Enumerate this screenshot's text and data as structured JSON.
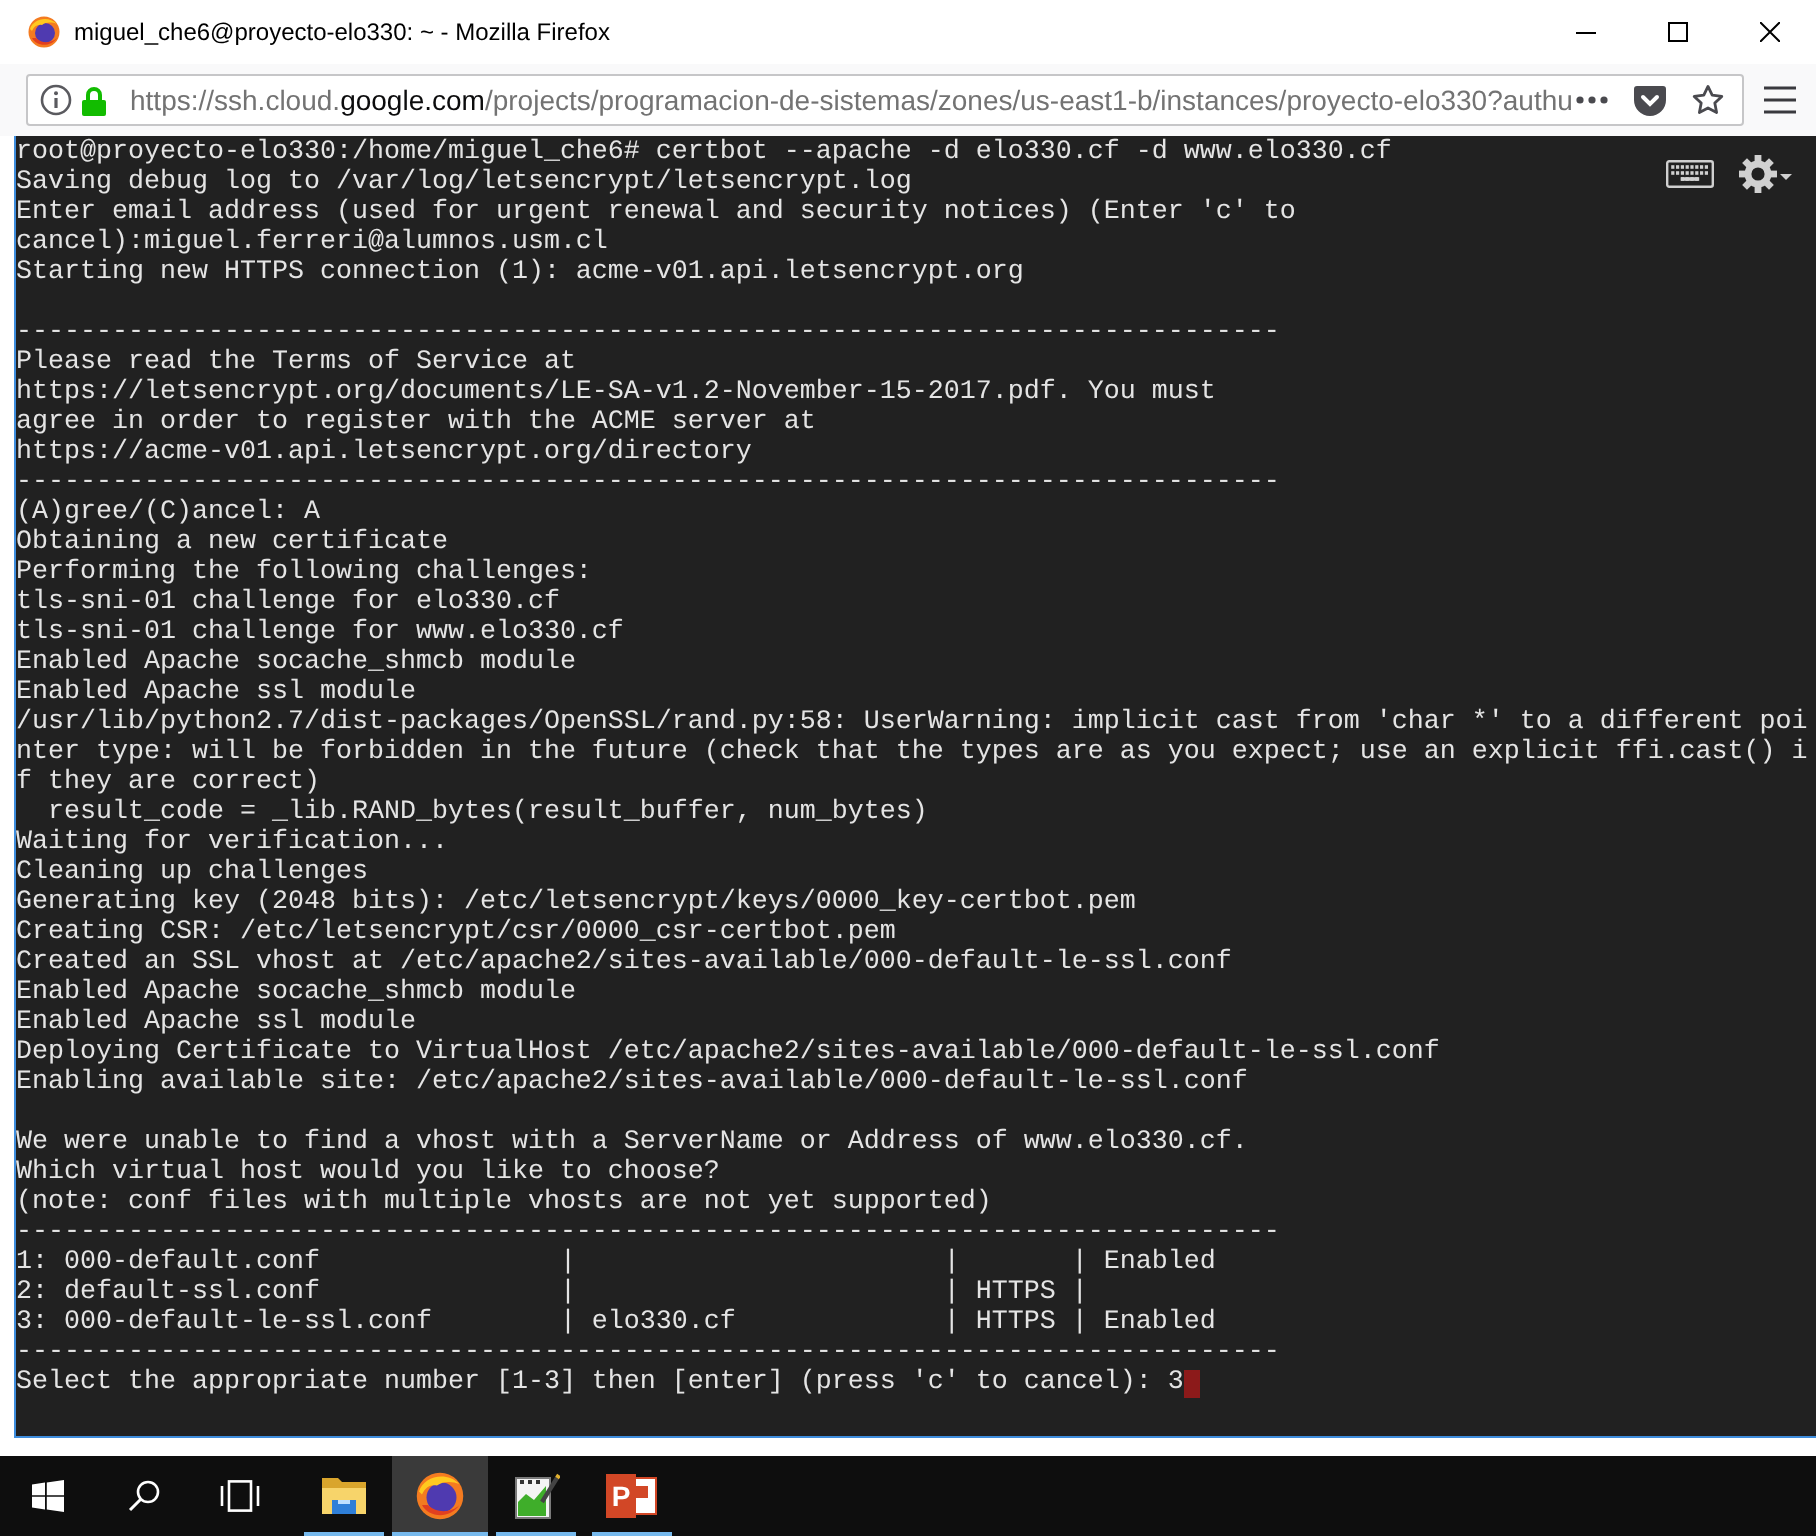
{
  "window": {
    "title": "miguel_che6@proyecto-elo330: ~ - Mozilla Firefox"
  },
  "address_bar": {
    "url": "https://ssh.cloud.**google.com**/projects/programacion-de-sistemas/zones/us-east1-b/instances/proyecto-elo330?authu",
    "secure": true
  },
  "terminal": {
    "blocks": [
      [
        "root@proyecto-elo330:/home/miguel_che6# certbot --apache -d elo330.cf -d www.elo330.cf",
        "Saving debug log to /var/log/letsencrypt/letsencrypt.log",
        "Enter email address (used for urgent renewal and security notices) (Enter 'c' to",
        "cancel):miguel.ferreri@alumnos.usm.cl",
        "Starting new HTTPS connection (1): acme-v01.api.letsencrypt.org"
      ],
      [
        "-------------------------------------------------------------------------------",
        "Please read the Terms of Service at",
        "https://letsencrypt.org/documents/LE-SA-v1.2-November-15-2017.pdf. You must",
        "agree in order to register with the ACME server at",
        "https://acme-v01.api.letsencrypt.org/directory",
        "-------------------------------------------------------------------------------",
        "(A)gree/(C)ancel: A",
        "Obtaining a new certificate",
        "Performing the following challenges:",
        "tls-sni-01 challenge for elo330.cf",
        "tls-sni-01 challenge for www.elo330.cf",
        "Enabled Apache socache_shmcb module",
        "Enabled Apache ssl module",
        "/usr/lib/python2.7/dist-packages/OpenSSL/rand.py:58: UserWarning: implicit cast from 'char *' to a different poi",
        "nter type: will be forbidden in the future (check that the types are as you expect; use an explicit ffi.cast() i",
        "f they are correct)",
        "  result_code = _lib.RAND_bytes(result_buffer, num_bytes)",
        "Waiting for verification...",
        "Cleaning up challenges",
        "Generating key (2048 bits): /etc/letsencrypt/keys/0000_key-certbot.pem",
        "Creating CSR: /etc/letsencrypt/csr/0000_csr-certbot.pem",
        "Created an SSL vhost at /etc/apache2/sites-available/000-default-le-ssl.conf",
        "Enabled Apache socache_shmcb module",
        "Enabled Apache ssl module",
        "Deploying Certificate to VirtualHost /etc/apache2/sites-available/000-default-le-ssl.conf",
        "Enabling available site: /etc/apache2/sites-available/000-default-le-ssl.conf"
      ],
      [
        "We were unable to find a vhost with a ServerName or Address of www.elo330.cf.",
        "Which virtual host would you like to choose?",
        "(note: conf files with multiple vhosts are not yet supported)",
        "-------------------------------------------------------------------------------",
        "1: 000-default.conf               |                       |       | Enabled",
        "2: default-ssl.conf               |                       | HTTPS |",
        "3: 000-default-le-ssl.conf        | elo330.cf             | HTTPS | Enabled",
        "-------------------------------------------------------------------------------",
        "Select the appropriate number [1-3] then [enter] (press 'c' to cancel): 3"
      ]
    ],
    "cursor": true
  },
  "taskbar": {
    "apps": [
      {
        "kind": "folder",
        "running": true,
        "active": false
      },
      {
        "kind": "browser",
        "running": true,
        "active": true
      },
      {
        "kind": "chart",
        "running": true,
        "active": false
      },
      {
        "kind": "slides",
        "glyph": "P",
        "running": true,
        "active": false
      }
    ]
  }
}
